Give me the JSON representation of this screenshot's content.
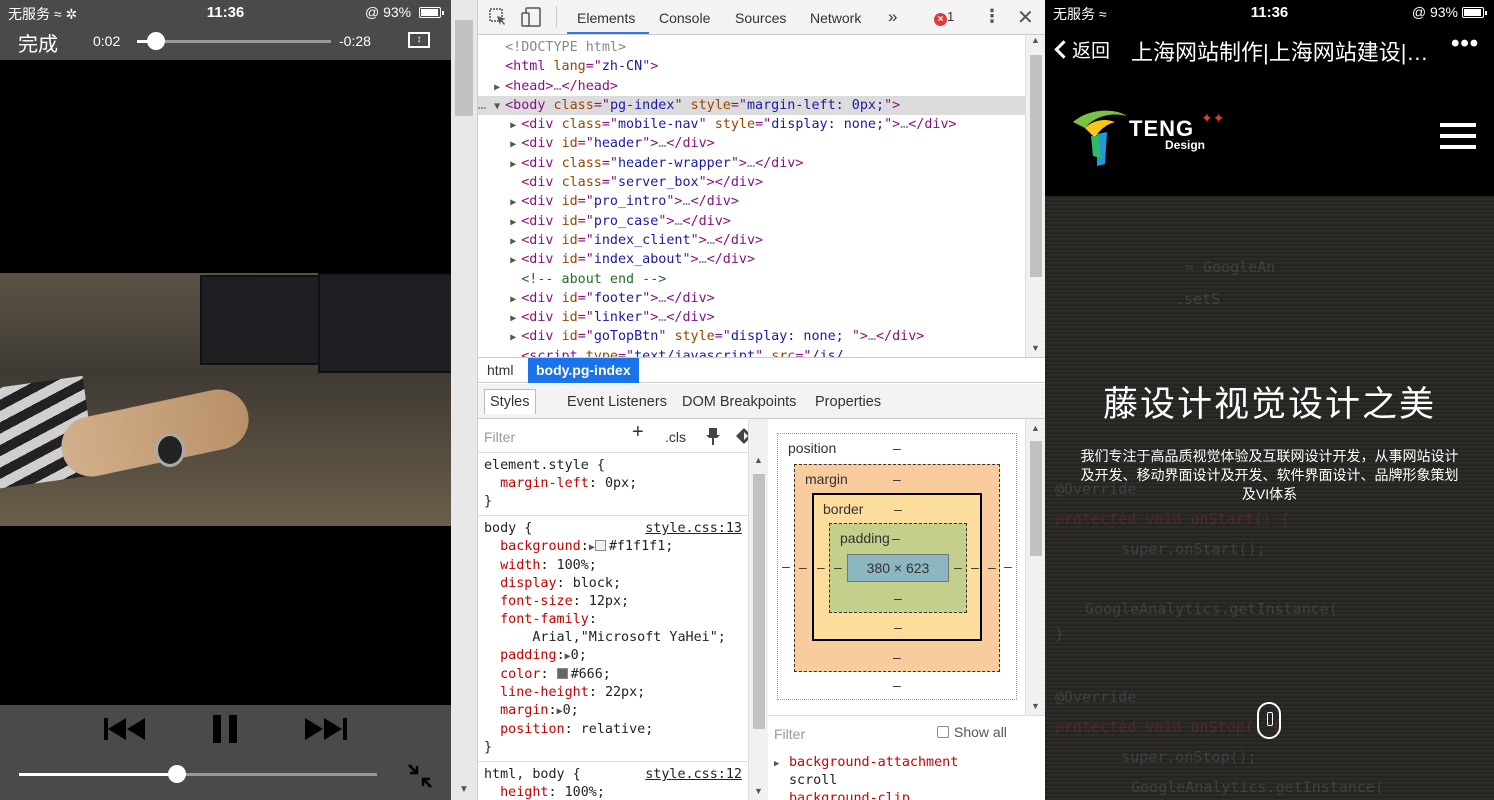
{
  "status_bar": {
    "carrier": "无服务",
    "time": "11:36",
    "battery": "93%"
  },
  "video_player": {
    "done_label": "完成",
    "elapsed": "0:02",
    "remaining": "-0:28",
    "progress_fraction": 0.1,
    "volume_fraction": 0.44
  },
  "devtools": {
    "tabs": [
      "Elements",
      "Console",
      "Sources",
      "Network"
    ],
    "more_tabs": "»",
    "error_count": "1",
    "dom_lines": [
      {
        "indent": 1,
        "tri": "",
        "parts": [
          [
            "gray",
            "<!DOCTYPE html>"
          ]
        ]
      },
      {
        "indent": 1,
        "tri": "",
        "parts": [
          [
            "tag",
            "<html "
          ],
          [
            "attr",
            "lang"
          ],
          [
            "tag",
            "=\""
          ],
          [
            "val",
            "zh-CN"
          ],
          [
            "tag",
            "\">"
          ]
        ]
      },
      {
        "indent": 1,
        "tri": "▶",
        "parts": [
          [
            "tag",
            "<head>"
          ],
          [
            "gray",
            "…"
          ],
          [
            "tag",
            "</head>"
          ]
        ]
      },
      {
        "indent": 1,
        "tri": "▼",
        "selected": true,
        "prefix": "…",
        "parts": [
          [
            "tag",
            "<body "
          ],
          [
            "attr",
            "class"
          ],
          [
            "tag",
            "=\""
          ],
          [
            "val",
            "pg-index"
          ],
          [
            "tag",
            "\" "
          ],
          [
            "attr",
            "style"
          ],
          [
            "tag",
            "=\""
          ],
          [
            "val",
            "margin-left: 0px;"
          ],
          [
            "tag",
            "\">"
          ]
        ]
      },
      {
        "indent": 2,
        "tri": "▶",
        "parts": [
          [
            "tag",
            "<div "
          ],
          [
            "attr",
            "class"
          ],
          [
            "tag",
            "=\""
          ],
          [
            "val",
            "mobile-nav"
          ],
          [
            "tag",
            "\" "
          ],
          [
            "attr",
            "style"
          ],
          [
            "tag",
            "=\""
          ],
          [
            "val",
            "display: none;"
          ],
          [
            "tag",
            "\">"
          ],
          [
            "gray",
            "…"
          ],
          [
            "tag",
            "</div>"
          ]
        ]
      },
      {
        "indent": 2,
        "tri": "▶",
        "parts": [
          [
            "tag",
            "<div "
          ],
          [
            "attr",
            "id"
          ],
          [
            "tag",
            "=\""
          ],
          [
            "val",
            "header"
          ],
          [
            "tag",
            "\">"
          ],
          [
            "gray",
            "…"
          ],
          [
            "tag",
            "</div>"
          ]
        ]
      },
      {
        "indent": 2,
        "tri": "▶",
        "parts": [
          [
            "tag",
            "<div "
          ],
          [
            "attr",
            "class"
          ],
          [
            "tag",
            "=\""
          ],
          [
            "val",
            "header-wrapper"
          ],
          [
            "tag",
            "\">"
          ],
          [
            "gray",
            "…"
          ],
          [
            "tag",
            "</div>"
          ]
        ]
      },
      {
        "indent": 2,
        "tri": "",
        "parts": [
          [
            "tag",
            "<div "
          ],
          [
            "attr",
            "class"
          ],
          [
            "tag",
            "=\""
          ],
          [
            "val",
            "server_box"
          ],
          [
            "tag",
            "\"></div>"
          ]
        ]
      },
      {
        "indent": 2,
        "tri": "▶",
        "parts": [
          [
            "tag",
            "<div "
          ],
          [
            "attr",
            "id"
          ],
          [
            "tag",
            "=\""
          ],
          [
            "val",
            "pro_intro"
          ],
          [
            "tag",
            "\">"
          ],
          [
            "gray",
            "…"
          ],
          [
            "tag",
            "</div>"
          ]
        ]
      },
      {
        "indent": 2,
        "tri": "▶",
        "parts": [
          [
            "tag",
            "<div "
          ],
          [
            "attr",
            "id"
          ],
          [
            "tag",
            "=\""
          ],
          [
            "val",
            "pro_case"
          ],
          [
            "tag",
            "\">"
          ],
          [
            "gray",
            "…"
          ],
          [
            "tag",
            "</div>"
          ]
        ]
      },
      {
        "indent": 2,
        "tri": "▶",
        "parts": [
          [
            "tag",
            "<div "
          ],
          [
            "attr",
            "id"
          ],
          [
            "tag",
            "=\""
          ],
          [
            "val",
            "index_client"
          ],
          [
            "tag",
            "\">"
          ],
          [
            "gray",
            "…"
          ],
          [
            "tag",
            "</div>"
          ]
        ]
      },
      {
        "indent": 2,
        "tri": "▶",
        "parts": [
          [
            "tag",
            "<div "
          ],
          [
            "attr",
            "id"
          ],
          [
            "tag",
            "=\""
          ],
          [
            "val",
            "index_about"
          ],
          [
            "tag",
            "\">"
          ],
          [
            "gray",
            "…"
          ],
          [
            "tag",
            "</div>"
          ]
        ]
      },
      {
        "indent": 2,
        "tri": "",
        "parts": [
          [
            "comment",
            "<!-- about end -->"
          ]
        ]
      },
      {
        "indent": 2,
        "tri": "▶",
        "parts": [
          [
            "tag",
            "<div "
          ],
          [
            "attr",
            "id"
          ],
          [
            "tag",
            "=\""
          ],
          [
            "val",
            "footer"
          ],
          [
            "tag",
            "\">"
          ],
          [
            "gray",
            "…"
          ],
          [
            "tag",
            "</div>"
          ]
        ]
      },
      {
        "indent": 2,
        "tri": "▶",
        "parts": [
          [
            "tag",
            "<div "
          ],
          [
            "attr",
            "id"
          ],
          [
            "tag",
            "=\""
          ],
          [
            "val",
            "linker"
          ],
          [
            "tag",
            "\">"
          ],
          [
            "gray",
            "…"
          ],
          [
            "tag",
            "</div>"
          ]
        ]
      },
      {
        "indent": 2,
        "tri": "▶",
        "parts": [
          [
            "tag",
            "<div "
          ],
          [
            "attr",
            "id"
          ],
          [
            "tag",
            "=\""
          ],
          [
            "val",
            "goTopBtn"
          ],
          [
            "tag",
            "\" "
          ],
          [
            "attr",
            "style"
          ],
          [
            "tag",
            "=\""
          ],
          [
            "val",
            "display: none; "
          ],
          [
            "tag",
            "\">"
          ],
          [
            "gray",
            "…"
          ],
          [
            "tag",
            "</div>"
          ]
        ]
      },
      {
        "indent": 2,
        "tri": "",
        "parts": [
          [
            "tag",
            "<script "
          ],
          [
            "attr",
            "type"
          ],
          [
            "tag",
            "=\""
          ],
          [
            "val",
            "text/javascript"
          ],
          [
            "tag",
            "\" "
          ],
          [
            "attr",
            "src"
          ],
          [
            "tag",
            "=\""
          ],
          [
            "val",
            "/js/"
          ]
        ]
      }
    ],
    "breadcrumb": [
      "html",
      "body.pg-index"
    ],
    "subtabs": [
      "Styles",
      "Event Listeners",
      "DOM Breakpoints",
      "Properties"
    ],
    "styles": {
      "filter_placeholder": "Filter",
      "plus": "+",
      "cls": ".cls",
      "element_style_selector": "element.style {",
      "element_style_prop": "margin-left",
      "element_style_val": "0px;",
      "close_brace": "}",
      "body_selector": "body {",
      "body_source": "style.css:13",
      "body_props": [
        {
          "prop": "background",
          "val": "#f1f1f1;",
          "swatch": "#f1f1f1",
          "arrow": true
        },
        {
          "prop": "width",
          "val": "100%;"
        },
        {
          "prop": "display",
          "val": "block;"
        },
        {
          "prop": "font-size",
          "val": "12px;"
        },
        {
          "prop": "font-family",
          "val": ""
        },
        {
          "prop": "",
          "val": "    Arial,\"Microsoft YaHei\";"
        },
        {
          "prop": "padding",
          "val": "0;",
          "arrow": true
        },
        {
          "prop": "color",
          "val": "#666;",
          "swatch": "#666666"
        },
        {
          "prop": "line-height",
          "val": "22px;"
        },
        {
          "prop": "margin",
          "val": "0;",
          "arrow": true
        },
        {
          "prop": "position",
          "val": "relative;"
        }
      ],
      "html_body_selector": "html, body {",
      "html_body_source": "style.css:12",
      "html_body_prop": "height",
      "html_body_val": "100%;"
    },
    "box_model": {
      "position_label": "position",
      "margin_label": "margin",
      "border_label": "border",
      "padding_label": "padding",
      "dash": "–",
      "content_size": "380 × 623"
    },
    "computed": {
      "filter_placeholder": "Filter",
      "show_all": "Show all",
      "rows": [
        {
          "prop": "background-attachment",
          "val": "scroll"
        },
        {
          "prop": "background-clip",
          "val": ""
        }
      ]
    }
  },
  "website": {
    "back_label": "返回",
    "title": "上海网站制作|上海网站建设|…",
    "more": "•••",
    "logo_text": "TENG",
    "logo_sub": "Design",
    "hero_title": "藤设计视觉设计之美",
    "hero_desc": "我们专注于高品质视觉体验及互联网设计开发，从事网站设计及开发、移动界面设计及开发、软件界面设计、品牌形象策划及VI体系",
    "code_lines": [
      "= GoogleAn",
      ".setS",
      "@Override",
      "protected void onStart() {",
      "    super.onStart();",
      "GoogleAnalytics.getInstance(",
      "}",
      "@Override",
      "protected void onStop() {",
      "    super.onStop();",
      "    GoogleAnalytics.getInstance("
    ]
  }
}
